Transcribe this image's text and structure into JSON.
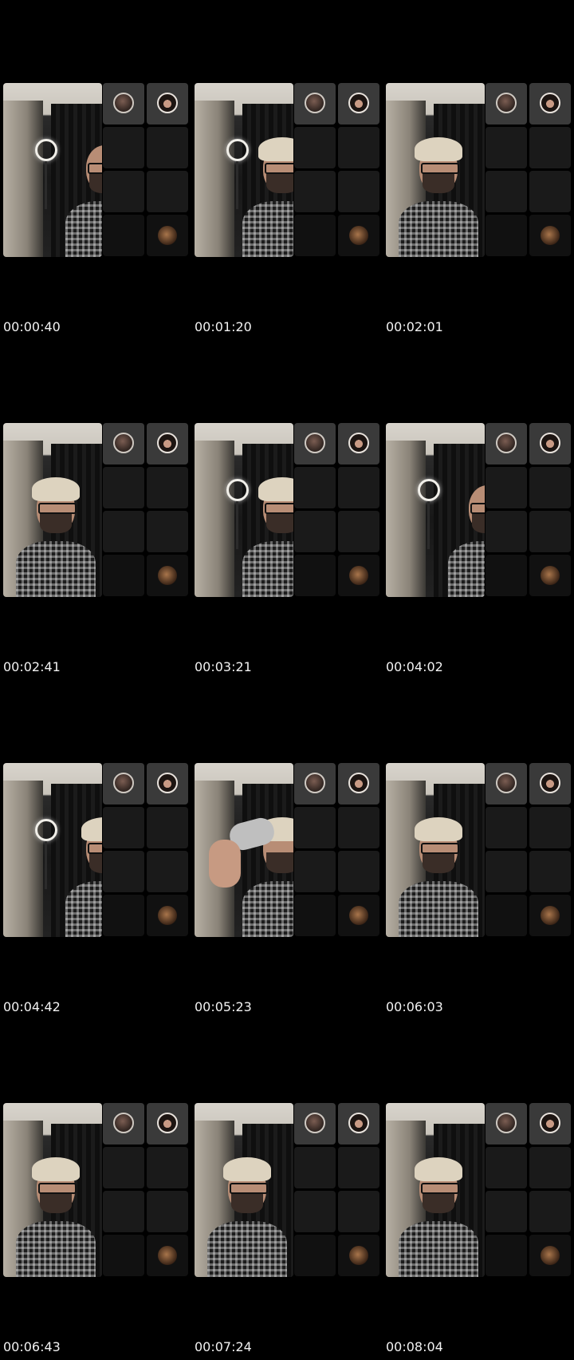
{
  "frames": [
    {
      "timestamp": "00:00:40"
    },
    {
      "timestamp": "00:01:20"
    },
    {
      "timestamp": "00:02:01"
    },
    {
      "timestamp": "00:02:41"
    },
    {
      "timestamp": "00:03:21"
    },
    {
      "timestamp": "00:04:02"
    },
    {
      "timestamp": "00:04:42"
    },
    {
      "timestamp": "00:05:23"
    },
    {
      "timestamp": "00:06:03"
    },
    {
      "timestamp": "00:06:43"
    },
    {
      "timestamp": "00:07:24"
    },
    {
      "timestamp": "00:08:04"
    }
  ],
  "colors": {
    "background": "#000000",
    "timestamp_text": "#f2f2f2",
    "tile_dark": "#1a1a1a",
    "tile_lit": "#3a3a3a"
  },
  "icons": {
    "participant_avatar_1": "man-avatar-icon",
    "participant_avatar_2": "woman-avatar-icon",
    "participant_avatar_3": "small-avatar-icon"
  }
}
